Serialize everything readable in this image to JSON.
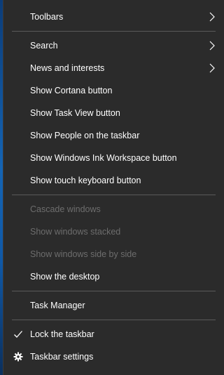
{
  "menu": {
    "toolbars": "Toolbars",
    "search": "Search",
    "news": "News and interests",
    "cortana": "Show Cortana button",
    "task_view": "Show Task View button",
    "people": "Show People on the taskbar",
    "ink": "Show Windows Ink Workspace button",
    "touch_keyboard": "Show touch keyboard button",
    "cascade": "Cascade windows",
    "stacked": "Show windows stacked",
    "side_by_side": "Show windows side by side",
    "desktop": "Show the desktop",
    "task_manager": "Task Manager",
    "lock": "Lock the taskbar",
    "settings": "Taskbar settings"
  },
  "icons": {
    "submenu": "chevron-right-icon",
    "check": "checkmark-icon",
    "settings": "gear-icon"
  },
  "colors": {
    "menu_bg": "#2b2b2b",
    "text": "#ffffff",
    "disabled_text": "#6d6d6d",
    "separator": "#5a5a5a",
    "desktop_blue": "#1464b4"
  }
}
